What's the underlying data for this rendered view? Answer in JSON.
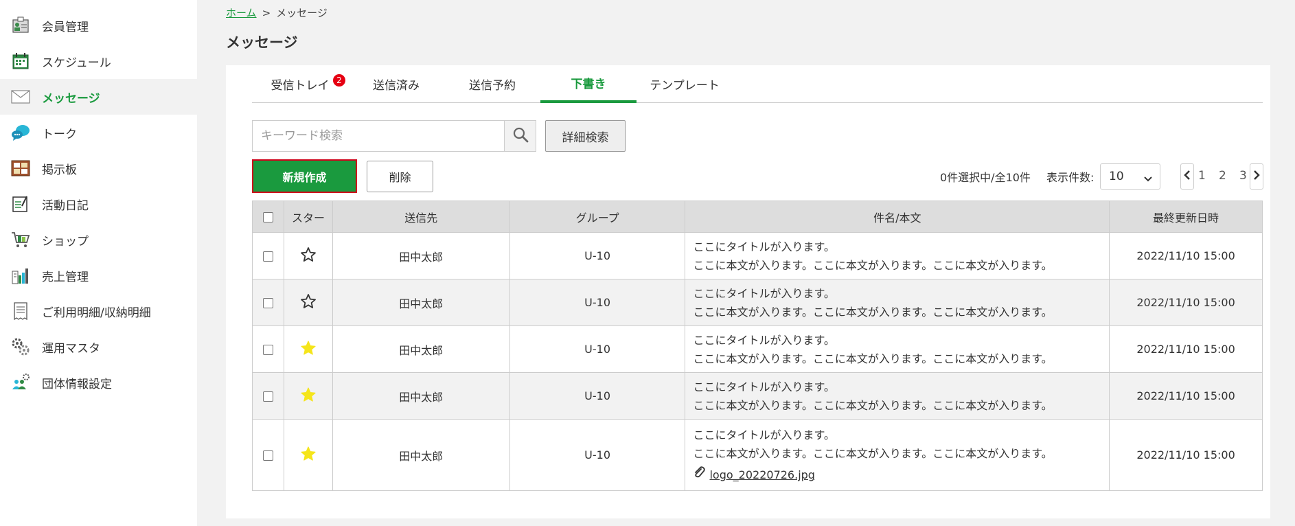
{
  "sidebar": {
    "items": [
      {
        "label": "会員管理",
        "icon": "member-card-icon"
      },
      {
        "label": "スケジュール",
        "icon": "calendar-icon"
      },
      {
        "label": "メッセージ",
        "icon": "envelope-icon"
      },
      {
        "label": "トーク",
        "icon": "chat-bubble-icon"
      },
      {
        "label": "掲示板",
        "icon": "bulletin-board-icon"
      },
      {
        "label": "活動日記",
        "icon": "diary-icon"
      },
      {
        "label": "ショップ",
        "icon": "shopping-cart-icon"
      },
      {
        "label": "売上管理",
        "icon": "sales-chart-icon"
      },
      {
        "label": "ご利用明細/収納明細",
        "icon": "receipt-icon"
      },
      {
        "label": "運用マスタ",
        "icon": "gear-tool-icon"
      },
      {
        "label": "団体情報設定",
        "icon": "group-settings-icon"
      }
    ],
    "active_index": 2
  },
  "breadcrumb": {
    "home": "ホーム",
    "separator": ">",
    "current": "メッセージ"
  },
  "page_title": "メッセージ",
  "tabs": [
    {
      "label": "受信トレイ",
      "badge": "2"
    },
    {
      "label": "送信済み"
    },
    {
      "label": "送信予約"
    },
    {
      "label": "下書き"
    },
    {
      "label": "テンプレート"
    }
  ],
  "active_tab": 3,
  "search": {
    "placeholder": "キーワード検索",
    "value": "",
    "advanced_label": "詳細検索"
  },
  "actions": {
    "new_label": "新規作成",
    "delete_label": "削除"
  },
  "selection_info": "0件選択中/全10件",
  "per_page": {
    "label": "表示件数:",
    "value": "10"
  },
  "pagination": {
    "pages": [
      "1",
      "2",
      "3"
    ]
  },
  "table": {
    "headers": {
      "star": "スター",
      "recipient": "送信先",
      "group": "グループ",
      "subject": "件名/本文",
      "updated": "最終更新日時"
    },
    "rows": [
      {
        "starred": false,
        "recipient": "田中太郎",
        "group": "U-10",
        "title": "ここにタイトルが入ります。",
        "body": "ここに本文が入ります。ここに本文が入ります。ここに本文が入ります。",
        "updated": "2022/11/10 15:00",
        "attachment": ""
      },
      {
        "starred": false,
        "recipient": "田中太郎",
        "group": "U-10",
        "title": "ここにタイトルが入ります。",
        "body": "ここに本文が入ります。ここに本文が入ります。ここに本文が入ります。",
        "updated": "2022/11/10 15:00",
        "attachment": ""
      },
      {
        "starred": true,
        "recipient": "田中太郎",
        "group": "U-10",
        "title": "ここにタイトルが入ります。",
        "body": "ここに本文が入ります。ここに本文が入ります。ここに本文が入ります。",
        "updated": "2022/11/10 15:00",
        "attachment": ""
      },
      {
        "starred": true,
        "recipient": "田中太郎",
        "group": "U-10",
        "title": "ここにタイトルが入ります。",
        "body": "ここに本文が入ります。ここに本文が入ります。ここに本文が入ります。",
        "updated": "2022/11/10 15:00",
        "attachment": ""
      },
      {
        "starred": true,
        "recipient": "田中太郎",
        "group": "U-10",
        "title": "ここにタイトルが入ります。",
        "body": "ここに本文が入ります。ここに本文が入ります。ここに本文が入ります。",
        "updated": "2022/11/10 15:00",
        "attachment": "logo_20220726.jpg"
      }
    ]
  },
  "colors": {
    "accent": "#1a9a3e",
    "badge": "#e60012",
    "star_filled": "#f5e51b",
    "highlight_border": "#d0021b"
  }
}
